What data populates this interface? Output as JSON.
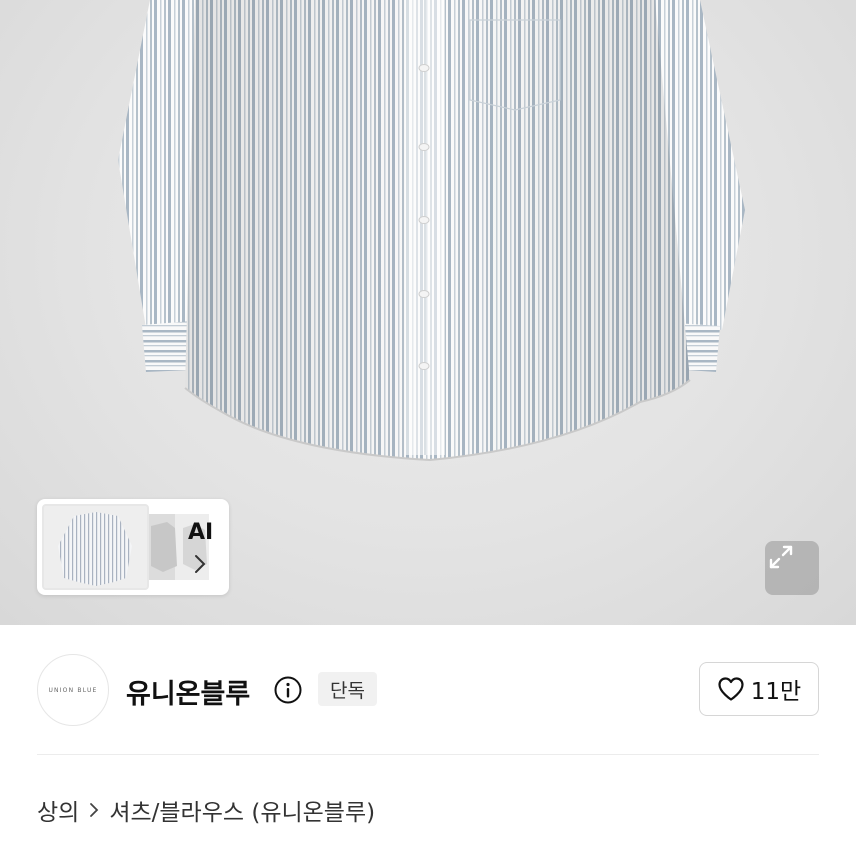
{
  "gallery": {
    "ai_label": "AI",
    "main_image": "striped-long-sleeve-shirt",
    "expand_icon": "expand-icon"
  },
  "brand": {
    "logo_text": "UNION BLUE",
    "name": "유니온블루",
    "badge": "단독",
    "like_count": "11만",
    "icons": {
      "info": "info-icon",
      "like": "heart-icon"
    }
  },
  "breadcrumb": {
    "category": "상의",
    "subcategory": "셔츠/블라우스 (유니온블루)"
  },
  "colors": {
    "hero_bg": "#e3e3e3",
    "stripe_blue": "#a9b7c4",
    "text_primary": "#111111",
    "badge_bg": "#f1f1f1",
    "border": "#d6d6d6"
  }
}
